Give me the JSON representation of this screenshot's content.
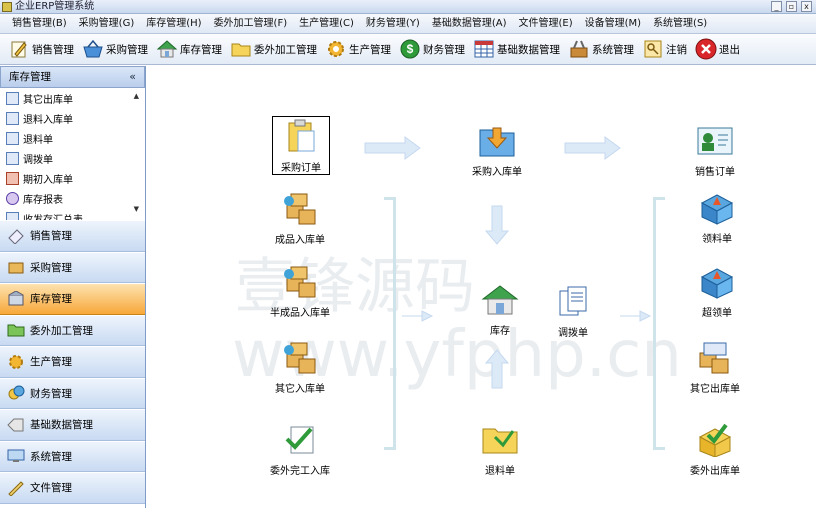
{
  "window": {
    "title": "企业ERP管理系统",
    "min": "_",
    "max": "▫",
    "close": "x"
  },
  "menubar": [
    "销售管理(B)",
    "采购管理(G)",
    "库存管理(H)",
    "委外加工管理(F)",
    "生产管理(C)",
    "财务管理(Y)",
    "基础数据管理(A)",
    "文件管理(E)",
    "设备管理(M)",
    "系统管理(S)"
  ],
  "toolbar": [
    {
      "label": "销售管理",
      "icon": "pencil-note-icon"
    },
    {
      "label": "采购管理",
      "icon": "basket-icon"
    },
    {
      "label": "库存管理",
      "icon": "house-icon"
    },
    {
      "label": "委外加工管理",
      "icon": "folder-icon"
    },
    {
      "label": "生产管理",
      "icon": "gear-icon"
    },
    {
      "label": "财务管理",
      "icon": "dollar-icon"
    },
    {
      "label": "基础数据管理",
      "icon": "grid-icon"
    },
    {
      "label": "系统管理",
      "icon": "tools-icon"
    },
    {
      "label": "注销",
      "icon": "key-icon"
    },
    {
      "label": "退出",
      "icon": "exit-icon"
    }
  ],
  "sidebar": {
    "header": "库存管理",
    "collapse": "«",
    "items": [
      "其它出库单",
      "退料入库单",
      "退料单",
      "调拨单",
      "期初入库单",
      "库存报表",
      "收发存汇总表"
    ],
    "categories": [
      {
        "label": "销售管理",
        "active": false
      },
      {
        "label": "采购管理",
        "active": false
      },
      {
        "label": "库存管理",
        "active": true
      },
      {
        "label": "委外加工管理",
        "active": false
      },
      {
        "label": "生产管理",
        "active": false
      },
      {
        "label": "财务管理",
        "active": false
      },
      {
        "label": "基础数据管理",
        "active": false
      },
      {
        "label": "系统管理",
        "active": false
      },
      {
        "label": "文件管理",
        "active": false
      }
    ]
  },
  "flow": {
    "purchase_order": "采购订单",
    "purchase_in": "采购入库单",
    "sales_order": "销售订单",
    "finished_in": "成品入库单",
    "semi_in": "半成品入库单",
    "other_in": "其它入库单",
    "outsource_done": "委外完工入库",
    "stock": "库存",
    "transfer": "调拨单",
    "return_material": "退料单",
    "picking": "领料单",
    "over_picking": "超领单",
    "other_out": "其它出库单",
    "outsource_out": "委外出库单"
  },
  "watermark": {
    "line1": "壹锋源码",
    "line2": "www.yfphp.cn"
  },
  "colors": {
    "accent": "#f7a83a",
    "menu_bg": "#dfe8f5",
    "arrow": "#dce9f7",
    "bracket": "#cfe3ea"
  }
}
